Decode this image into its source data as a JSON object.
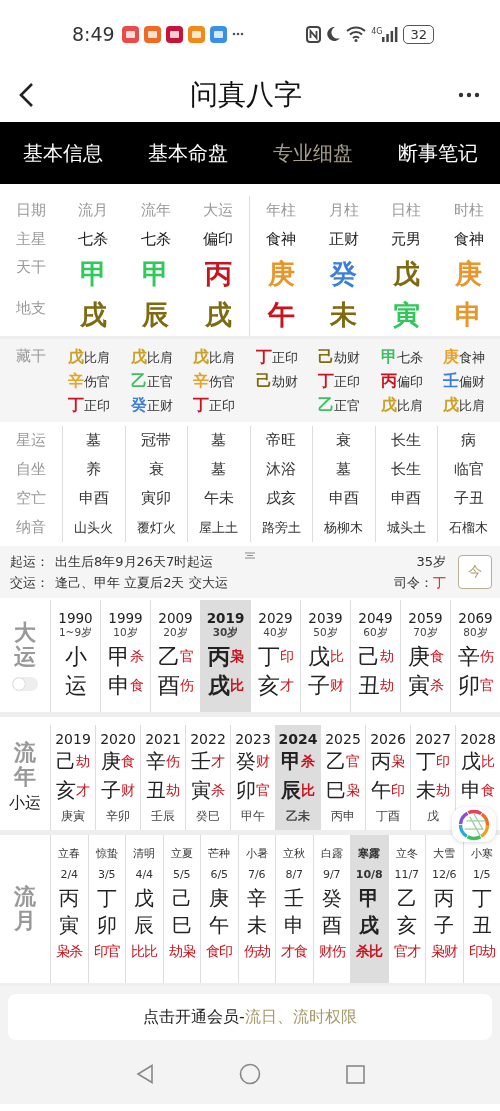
{
  "status_bar": {
    "time": "8:49",
    "network": "4G",
    "battery": "32"
  },
  "header": {
    "title": "问真八字"
  },
  "tabs": [
    {
      "label": "基本信息",
      "selected": false
    },
    {
      "label": "基本命盘",
      "selected": false
    },
    {
      "label": "专业细盘",
      "selected": true
    },
    {
      "label": "断事笔记",
      "selected": false
    }
  ],
  "pillars": {
    "row_labels": [
      "日期",
      "主星",
      "天干",
      "地支"
    ],
    "columns": [
      {
        "label": "流月",
        "star": "七杀",
        "stem": {
          "char": "甲",
          "color": "#2fc95a"
        },
        "branch": {
          "char": "戌",
          "color": "#7d6a12"
        }
      },
      {
        "label": "流年",
        "star": "七杀",
        "stem": {
          "char": "甲",
          "color": "#2fc95a"
        },
        "branch": {
          "char": "辰",
          "color": "#7d6a12"
        }
      },
      {
        "label": "大运",
        "star": "偏印",
        "stem": {
          "char": "丙",
          "color": "#c8141e"
        },
        "branch": {
          "char": "戌",
          "color": "#7d6a12"
        }
      },
      {
        "label": "年柱",
        "star": "食神",
        "stem": {
          "char": "庚",
          "color": "#e6962a"
        },
        "branch": {
          "char": "午",
          "color": "#c8141e"
        }
      },
      {
        "label": "月柱",
        "star": "正财",
        "stem": {
          "char": "癸",
          "color": "#3b7fd6"
        },
        "branch": {
          "char": "未",
          "color": "#7d6a12"
        }
      },
      {
        "label": "日柱",
        "star": "元男",
        "stem": {
          "char": "戊",
          "color": "#7d6a12"
        },
        "branch": {
          "char": "寅",
          "color": "#2fc95a"
        }
      },
      {
        "label": "时柱",
        "star": "食神",
        "stem": {
          "char": "庚",
          "color": "#e6962a"
        },
        "branch": {
          "char": "申",
          "color": "#e6962a"
        }
      }
    ]
  },
  "hidden_stems": {
    "label": "藏干",
    "columns": [
      [
        {
          "stem": "戊",
          "color": "#c9a227",
          "god": "比肩"
        },
        {
          "stem": "辛",
          "color": "#e6a52a",
          "god": "伤官"
        },
        {
          "stem": "丁",
          "color": "#c8141e",
          "god": "正印"
        }
      ],
      [
        {
          "stem": "戊",
          "color": "#c9a227",
          "god": "比肩"
        },
        {
          "stem": "乙",
          "color": "#3fc060",
          "god": "正官"
        },
        {
          "stem": "癸",
          "color": "#3b7fd6",
          "god": "正财"
        }
      ],
      [
        {
          "stem": "戊",
          "color": "#c9a227",
          "god": "比肩"
        },
        {
          "stem": "辛",
          "color": "#e6a52a",
          "god": "伤官"
        },
        {
          "stem": "丁",
          "color": "#c8141e",
          "god": "正印"
        }
      ],
      [
        {
          "stem": "丁",
          "color": "#c8141e",
          "god": "正印"
        },
        {
          "stem": "己",
          "color": "#7d6a12",
          "god": "劫财"
        }
      ],
      [
        {
          "stem": "己",
          "color": "#7d6a12",
          "god": "劫财"
        },
        {
          "stem": "丁",
          "color": "#c8141e",
          "god": "正印"
        },
        {
          "stem": "乙",
          "color": "#3fc060",
          "god": "正官"
        }
      ],
      [
        {
          "stem": "甲",
          "color": "#3fc060",
          "god": "七杀"
        },
        {
          "stem": "丙",
          "color": "#c8141e",
          "god": "偏印"
        },
        {
          "stem": "戊",
          "color": "#c9a227",
          "god": "比肩"
        }
      ],
      [
        {
          "stem": "庚",
          "color": "#e6a52a",
          "god": "食神"
        },
        {
          "stem": "壬",
          "color": "#3b7fd6",
          "god": "偏财"
        },
        {
          "stem": "戊",
          "color": "#c9a227",
          "god": "比肩"
        }
      ]
    ]
  },
  "details": [
    {
      "label": "星运",
      "values": [
        "墓",
        "冠带",
        "墓",
        "帝旺",
        "衰",
        "长生",
        "病"
      ]
    },
    {
      "label": "自坐",
      "values": [
        "养",
        "衰",
        "墓",
        "沐浴",
        "墓",
        "长生",
        "临官"
      ]
    },
    {
      "label": "空亡",
      "values": [
        "申酉",
        "寅卯",
        "午未",
        "戌亥",
        "申酉",
        "申酉",
        "子丑"
      ]
    },
    {
      "label": "纳音",
      "values": [
        "山头火",
        "覆灯火",
        "屋上土",
        "路旁土",
        "杨柳木",
        "城头土",
        "石榴木"
      ]
    }
  ],
  "qiyun": {
    "rows": [
      {
        "label": "起运：",
        "text": "出生后8年9月26天7时起运"
      },
      {
        "label": "交运：",
        "text": "逢己、甲年 立夏后2天 交大运"
      }
    ],
    "age": "35岁",
    "siling_label": "司令：",
    "siling": "丁",
    "today_button": "今"
  },
  "dayun": {
    "label": "大运",
    "toggle_on": false,
    "columns": [
      {
        "year": "1990",
        "age": "1~9岁",
        "stem": "小",
        "branch": "运",
        "selected": false
      },
      {
        "year": "1999",
        "age": "10岁",
        "stem": "甲",
        "stem_god": "杀",
        "branch": "申",
        "branch_god": "食",
        "selected": false
      },
      {
        "year": "2009",
        "age": "20岁",
        "stem": "乙",
        "stem_god": "官",
        "branch": "酉",
        "branch_god": "伤",
        "selected": false
      },
      {
        "year": "2019",
        "age": "30岁",
        "stem": "丙",
        "stem_god": "枭",
        "branch": "戌",
        "branch_god": "比",
        "selected": true
      },
      {
        "year": "2029",
        "age": "40岁",
        "stem": "丁",
        "stem_god": "印",
        "branch": "亥",
        "branch_god": "才",
        "selected": false
      },
      {
        "year": "2039",
        "age": "50岁",
        "stem": "戊",
        "stem_god": "比",
        "branch": "子",
        "branch_god": "财",
        "selected": false
      },
      {
        "year": "2049",
        "age": "60岁",
        "stem": "己",
        "stem_god": "劫",
        "branch": "丑",
        "branch_god": "劫",
        "selected": false
      },
      {
        "year": "2059",
        "age": "70岁",
        "stem": "庚",
        "stem_god": "食",
        "branch": "寅",
        "branch_god": "杀",
        "selected": false
      },
      {
        "year": "2069",
        "age": "80岁",
        "stem": "辛",
        "stem_god": "伤",
        "branch": "卯",
        "branch_god": "官",
        "selected": false
      }
    ]
  },
  "liunian": {
    "label": "流年",
    "sub_label": "小运",
    "columns": [
      {
        "year": "2019",
        "stem": "己",
        "stem_god": "劫",
        "branch": "亥",
        "branch_god": "才",
        "sub": "庚寅",
        "selected": false
      },
      {
        "year": "2020",
        "stem": "庚",
        "stem_god": "食",
        "branch": "子",
        "branch_god": "财",
        "sub": "辛卯",
        "selected": false
      },
      {
        "year": "2021",
        "stem": "辛",
        "stem_god": "伤",
        "branch": "丑",
        "branch_god": "劫",
        "sub": "壬辰",
        "selected": false
      },
      {
        "year": "2022",
        "stem": "壬",
        "stem_god": "才",
        "branch": "寅",
        "branch_god": "杀",
        "sub": "癸巳",
        "selected": false
      },
      {
        "year": "2023",
        "stem": "癸",
        "stem_god": "财",
        "branch": "卯",
        "branch_god": "官",
        "sub": "甲午",
        "selected": false
      },
      {
        "year": "2024",
        "stem": "甲",
        "stem_god": "杀",
        "branch": "辰",
        "branch_god": "比",
        "sub": "乙未",
        "selected": true
      },
      {
        "year": "2025",
        "stem": "乙",
        "stem_god": "官",
        "branch": "巳",
        "branch_god": "枭",
        "sub": "丙申",
        "selected": false
      },
      {
        "year": "2026",
        "stem": "丙",
        "stem_god": "枭",
        "branch": "午",
        "branch_god": "印",
        "sub": "丁酉",
        "selected": false
      },
      {
        "year": "2027",
        "stem": "丁",
        "stem_god": "印",
        "branch": "未",
        "branch_god": "劫",
        "sub": "戊",
        "selected": false
      },
      {
        "year": "2028",
        "stem": "戊",
        "stem_god": "比",
        "branch": "申",
        "branch_god": "食",
        "selected": false
      }
    ]
  },
  "liuyue": {
    "label": "流月",
    "columns": [
      {
        "term": "立春",
        "date": "2/4",
        "stem": "丙",
        "branch": "寅",
        "gods": "枭杀",
        "selected": false
      },
      {
        "term": "惊蛰",
        "date": "3/5",
        "stem": "丁",
        "branch": "卯",
        "gods": "印官",
        "selected": false
      },
      {
        "term": "清明",
        "date": "4/4",
        "stem": "戊",
        "branch": "辰",
        "gods": "比比",
        "selected": false
      },
      {
        "term": "立夏",
        "date": "5/5",
        "stem": "己",
        "branch": "巳",
        "gods": "劫枭",
        "selected": false
      },
      {
        "term": "芒种",
        "date": "6/5",
        "stem": "庚",
        "branch": "午",
        "gods": "食印",
        "selected": false
      },
      {
        "term": "小暑",
        "date": "7/6",
        "stem": "辛",
        "branch": "未",
        "gods": "伤劫",
        "selected": false
      },
      {
        "term": "立秋",
        "date": "8/7",
        "stem": "壬",
        "branch": "申",
        "gods": "才食",
        "selected": false
      },
      {
        "term": "白露",
        "date": "9/7",
        "stem": "癸",
        "branch": "酉",
        "gods": "财伤",
        "selected": false
      },
      {
        "term": "寒露",
        "date": "10/8",
        "stem": "甲",
        "branch": "戌",
        "gods": "杀比",
        "selected": true
      },
      {
        "term": "立冬",
        "date": "11/7",
        "stem": "乙",
        "branch": "亥",
        "gods": "官才",
        "selected": false
      },
      {
        "term": "大雪",
        "date": "12/6",
        "stem": "丙",
        "branch": "子",
        "gods": "枭财",
        "selected": false
      },
      {
        "term": "小寒",
        "date": "1/5",
        "stem": "丁",
        "branch": "丑",
        "gods": "印劫",
        "selected": false
      }
    ]
  },
  "vip_banner": {
    "text": "点击开通会员-",
    "link": "流日、流时权限"
  }
}
